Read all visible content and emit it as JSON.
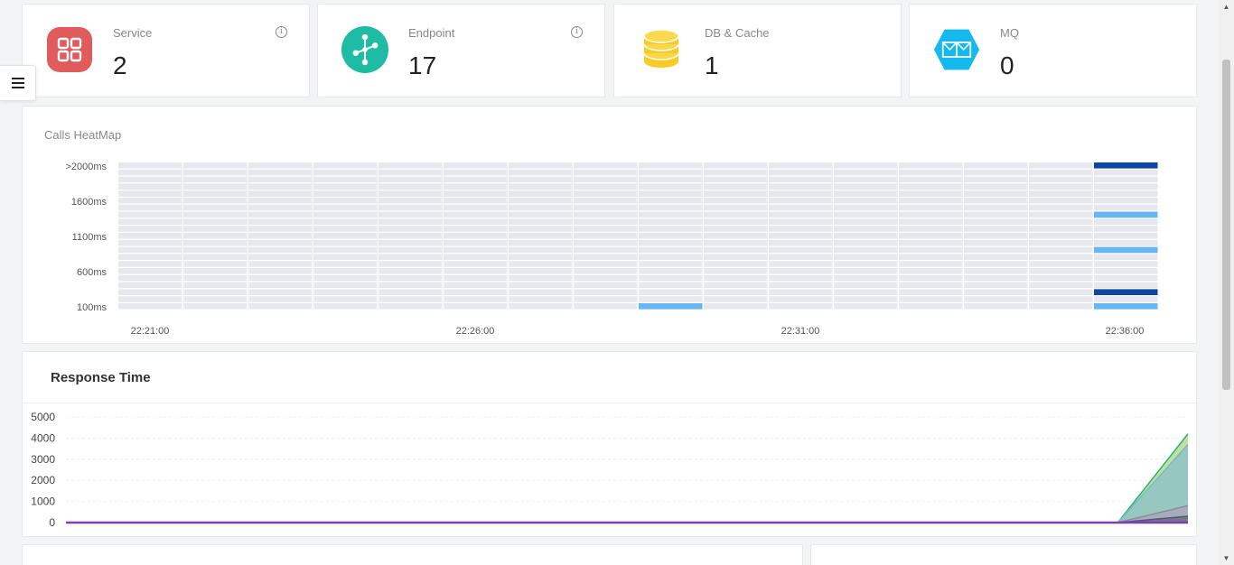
{
  "stats": [
    {
      "label": "Service",
      "value": "2",
      "icon": "grid-icon",
      "color": "#e05b5b",
      "info": true
    },
    {
      "label": "Endpoint",
      "value": "17",
      "icon": "network-icon",
      "color": "#1ebca5",
      "info": true
    },
    {
      "label": "DB & Cache",
      "value": "1",
      "icon": "database-icon",
      "color": "#fbcb22",
      "info": false
    },
    {
      "label": "MQ",
      "value": "0",
      "icon": "mail-icon",
      "color": "#14b9ee",
      "info": false
    }
  ],
  "heatmap": {
    "title": "Calls HeatMap",
    "y_labels": [
      ">2000ms",
      "1600ms",
      "1100ms",
      "600ms",
      "100ms"
    ],
    "x_labels": [
      "22:21:00",
      "22:26:00",
      "22:31:00",
      "22:36:00"
    ],
    "colors": {
      "empty": "#e6e8ee",
      "low": "#66b6f4",
      "high": "#0d47a1"
    }
  },
  "response_time": {
    "title": "Response Time",
    "y_ticks": [
      "5000",
      "4000",
      "3000",
      "2000",
      "1000",
      "0"
    ],
    "ylim": [
      0,
      5000
    ],
    "x_count": 17,
    "series": [
      {
        "color": "#b9d98e",
        "line": "#22b573",
        "values": [
          0,
          0,
          0,
          0,
          0,
          0,
          0,
          0,
          0,
          0,
          0,
          0,
          0,
          0,
          0,
          0,
          4200
        ]
      },
      {
        "color": "#8fc4c4",
        "line": "#7ab8c8",
        "values": [
          0,
          0,
          0,
          0,
          0,
          0,
          0,
          0,
          0,
          0,
          0,
          0,
          0,
          0,
          0,
          0,
          3700
        ]
      },
      {
        "color": "#a8a8b8",
        "line": "#8c8ca0",
        "values": [
          0,
          0,
          0,
          0,
          0,
          0,
          0,
          0,
          0,
          0,
          0,
          0,
          0,
          0,
          0,
          0,
          800
        ]
      },
      {
        "color": "#6c6c88",
        "line": "#55557a",
        "values": [
          0,
          0,
          0,
          0,
          0,
          0,
          0,
          0,
          0,
          0,
          0,
          0,
          0,
          0,
          0,
          0,
          300
        ]
      },
      {
        "color": "#7c3fb0",
        "line": "#7c3fb0",
        "values": [
          0,
          0,
          0,
          0,
          0,
          0,
          0,
          0,
          0,
          0,
          0,
          0,
          0,
          0,
          0,
          0,
          0
        ]
      }
    ]
  }
}
